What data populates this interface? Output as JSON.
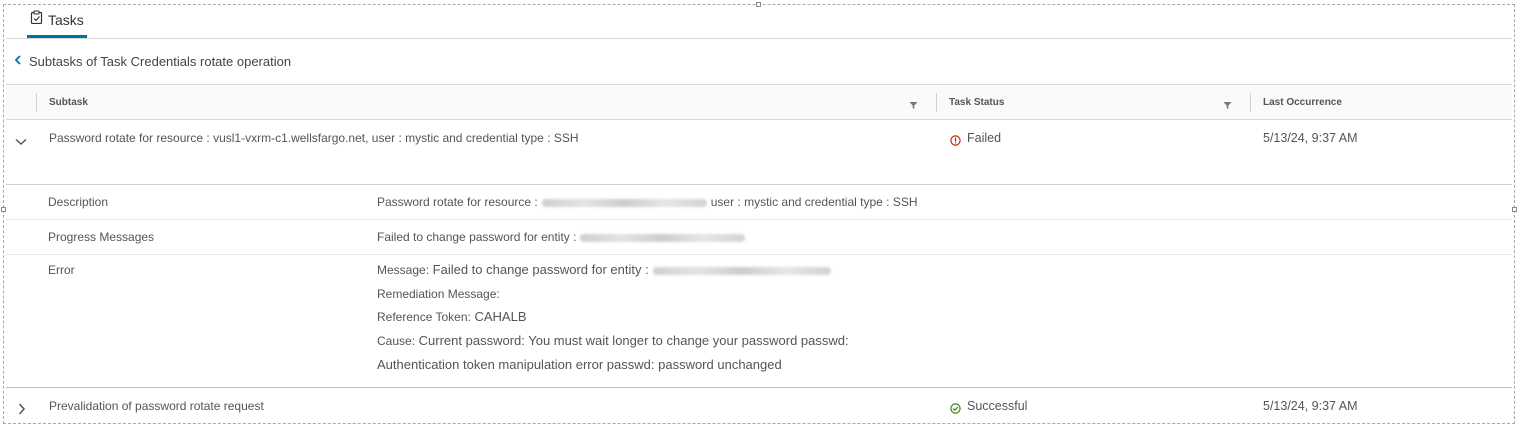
{
  "tab": {
    "label": "Tasks",
    "icon": "clipboard-icon"
  },
  "breadcrumb": {
    "label": "Subtasks of Task Credentials rotate operation",
    "icon": "chevron-left-icon"
  },
  "columns": [
    {
      "label": "Subtask",
      "filter_icon": "filter-icon"
    },
    {
      "label": "Task Status",
      "filter_icon": "filter-icon"
    },
    {
      "label": "Last Occurrence"
    }
  ],
  "rows": [
    {
      "subtask": "Password rotate for resource : vusl1-vxrm-c1.wellsfargo.net, user : mystic and credential type : SSH",
      "status": "Failed",
      "status_icon": "error-circle-icon",
      "status_color": "#c92100",
      "last": "5/13/24, 9:37 AM",
      "expanded": true
    },
    {
      "subtask": "Prevalidation of password rotate request",
      "status": "Successful",
      "status_icon": "check-circle-icon",
      "status_color": "#318700",
      "last": "5/13/24, 9:37 AM",
      "expanded": false
    }
  ],
  "details": {
    "description": {
      "label": "Description",
      "prefix": "Password rotate for resource :",
      "suffix": "user : mystic and credential type : SSH"
    },
    "progress": {
      "label": "Progress Messages",
      "prefix": "Failed to change password for entity :"
    },
    "error": {
      "label": "Error",
      "message_key": "Message:",
      "message_value": "Failed to change password for entity :",
      "remediation_key": "Remediation Message:",
      "reference_key": "Reference Token:",
      "reference_value": "CAHALB",
      "cause_key": "Cause:",
      "cause_value_1": "Current password: You must wait longer to change your password passwd:",
      "cause_value_2": "Authentication token manipulation error passwd: password unchanged"
    }
  },
  "colors": {
    "accent": "#0072a3"
  }
}
